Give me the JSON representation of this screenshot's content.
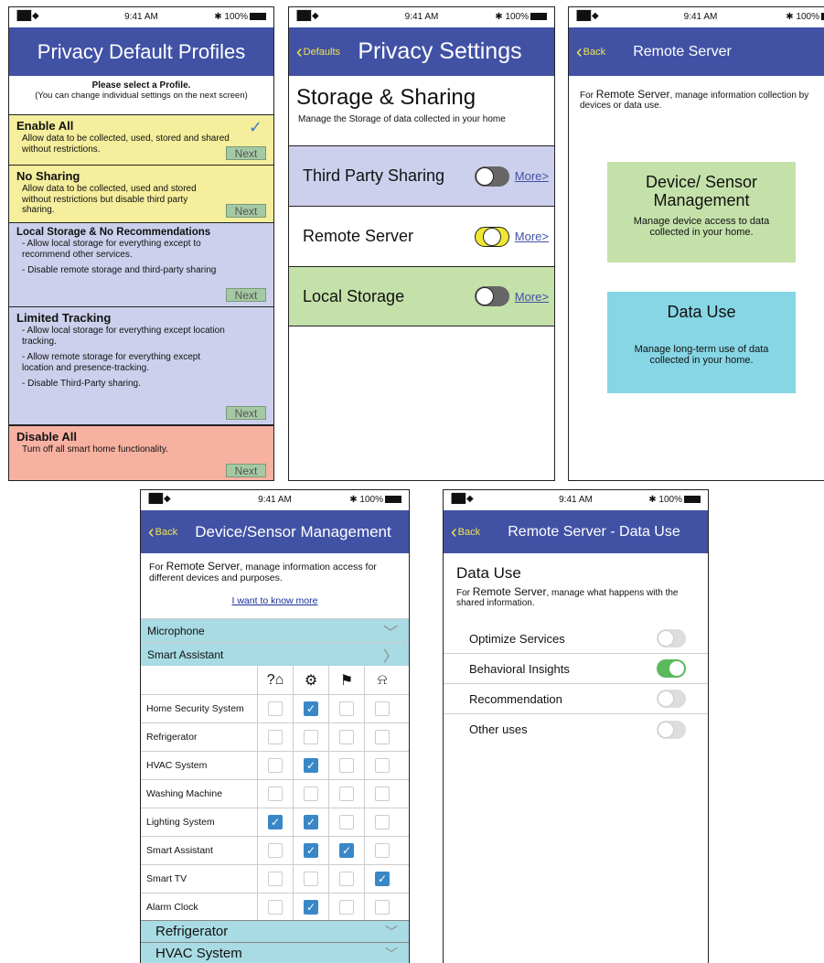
{
  "status": {
    "time": "9:41 AM",
    "battery": "100%",
    "signal": "▐██ ◆"
  },
  "colors": {
    "header": "#4152a5",
    "back_link": "#f2e24a",
    "enable_all": "#f5ee9c",
    "local": "#cdd0ec",
    "disable": "#f7b1a1",
    "third_party": "#cdd0ec",
    "local_storage": "#c4e1aa",
    "device_card": "#c4e1aa",
    "data_card": "#86d6e5",
    "accordion": "#a8dbe3",
    "toggle_on": "#5cb85c"
  },
  "phone1": {
    "title": "Privacy Default Profiles",
    "instruction_bold": "Please select a Profile.",
    "instruction": "(You can change individual settings on the next screen)",
    "profiles": [
      {
        "title": "Enable All",
        "lines": [
          "Allow data to be collected, used, stored and shared without restrictions."
        ],
        "next": "Next",
        "selected": true
      },
      {
        "title": "No Sharing",
        "lines": [
          "Allow data to be collected, used and stored without restrictions but disable third party sharing."
        ],
        "next": "Next"
      },
      {
        "title": "Local Storage & No Recommendations",
        "lines": [
          "- Allow local storage for everything except to recommend other services.",
          "- Disable remote storage and third-party sharing"
        ],
        "next": "Next"
      },
      {
        "title": "Limited Tracking",
        "lines": [
          "- Allow local storage for everything except location tracking.",
          "- Allow remote storage for everything except location and presence-tracking.",
          "- Disable Third-Party sharing."
        ],
        "next": "Next"
      },
      {
        "title": "Disable All",
        "lines": [
          "Turn off all smart home functionality."
        ],
        "next": "Next"
      }
    ]
  },
  "phone2": {
    "back": "Defaults",
    "title": "Privacy Settings",
    "section_title": "Storage & Sharing",
    "section_sub": "Manage the Storage of data collected in your home",
    "rows": [
      {
        "label": "Third Party Sharing",
        "more": "More>"
      },
      {
        "label": "Remote Server",
        "more": "More>"
      },
      {
        "label": "Local Storage",
        "more": "More>"
      }
    ]
  },
  "phone3": {
    "back": "Back",
    "title": "Remote Server",
    "intro_prefix": "For",
    "intro_em": "Remote Server",
    "intro_rest": ", manage information collection by devices or data use.",
    "cards": [
      {
        "title": "Device/ Sensor Management",
        "desc": "Manage device access to data collected in your home."
      },
      {
        "title": "Data Use",
        "desc": "Manage long-term use of data collected in your home."
      }
    ]
  },
  "phone4": {
    "back": "Back",
    "title": "Device/Sensor Management",
    "intro_prefix": "For",
    "intro_em": "Remote Server",
    "intro_rest": ", manage information access for different devices and purposes.",
    "link": "I want to know more",
    "accordions_top": [
      {
        "label": "Microphone",
        "chevron": "﹀"
      },
      {
        "label": "Smart Assistant",
        "chevron": "〉"
      }
    ],
    "column_icons": [
      "home-question-icon",
      "gears-icon",
      "home-location-icon",
      "bell-icon"
    ],
    "column_glyphs": [
      "?⌂",
      "⚙",
      "⚑",
      "⍾"
    ],
    "devices": [
      {
        "name": "Home Security System",
        "checks": [
          false,
          true,
          false,
          false
        ]
      },
      {
        "name": "Refrigerator",
        "checks": [
          false,
          false,
          false,
          false
        ]
      },
      {
        "name": "HVAC System",
        "checks": [
          false,
          true,
          false,
          false
        ]
      },
      {
        "name": "Washing Machine",
        "checks": [
          false,
          false,
          false,
          false
        ]
      },
      {
        "name": "Lighting System",
        "checks": [
          true,
          true,
          false,
          false
        ]
      },
      {
        "name": "Smart Assistant",
        "checks": [
          false,
          true,
          true,
          false
        ]
      },
      {
        "name": "Smart TV",
        "checks": [
          false,
          false,
          false,
          true
        ]
      },
      {
        "name": "Alarm Clock",
        "checks": [
          false,
          true,
          false,
          false
        ]
      }
    ],
    "accordions_bottom": [
      {
        "label": "Refrigerator",
        "chevron": "﹀"
      },
      {
        "label": "HVAC System",
        "chevron": "﹀"
      }
    ]
  },
  "phone5": {
    "back": "Back",
    "title": "Remote Server - Data Use",
    "section_title": "Data Use",
    "intro_prefix": "For",
    "intro_em": "Remote Server",
    "intro_rest": ", manage what happens with the shared information.",
    "settings": [
      {
        "label": "Optimize Services",
        "on": false
      },
      {
        "label": "Behavioral Insights",
        "on": true
      },
      {
        "label": "Recommendation",
        "on": false
      },
      {
        "label": "Other uses",
        "on": false
      }
    ]
  }
}
